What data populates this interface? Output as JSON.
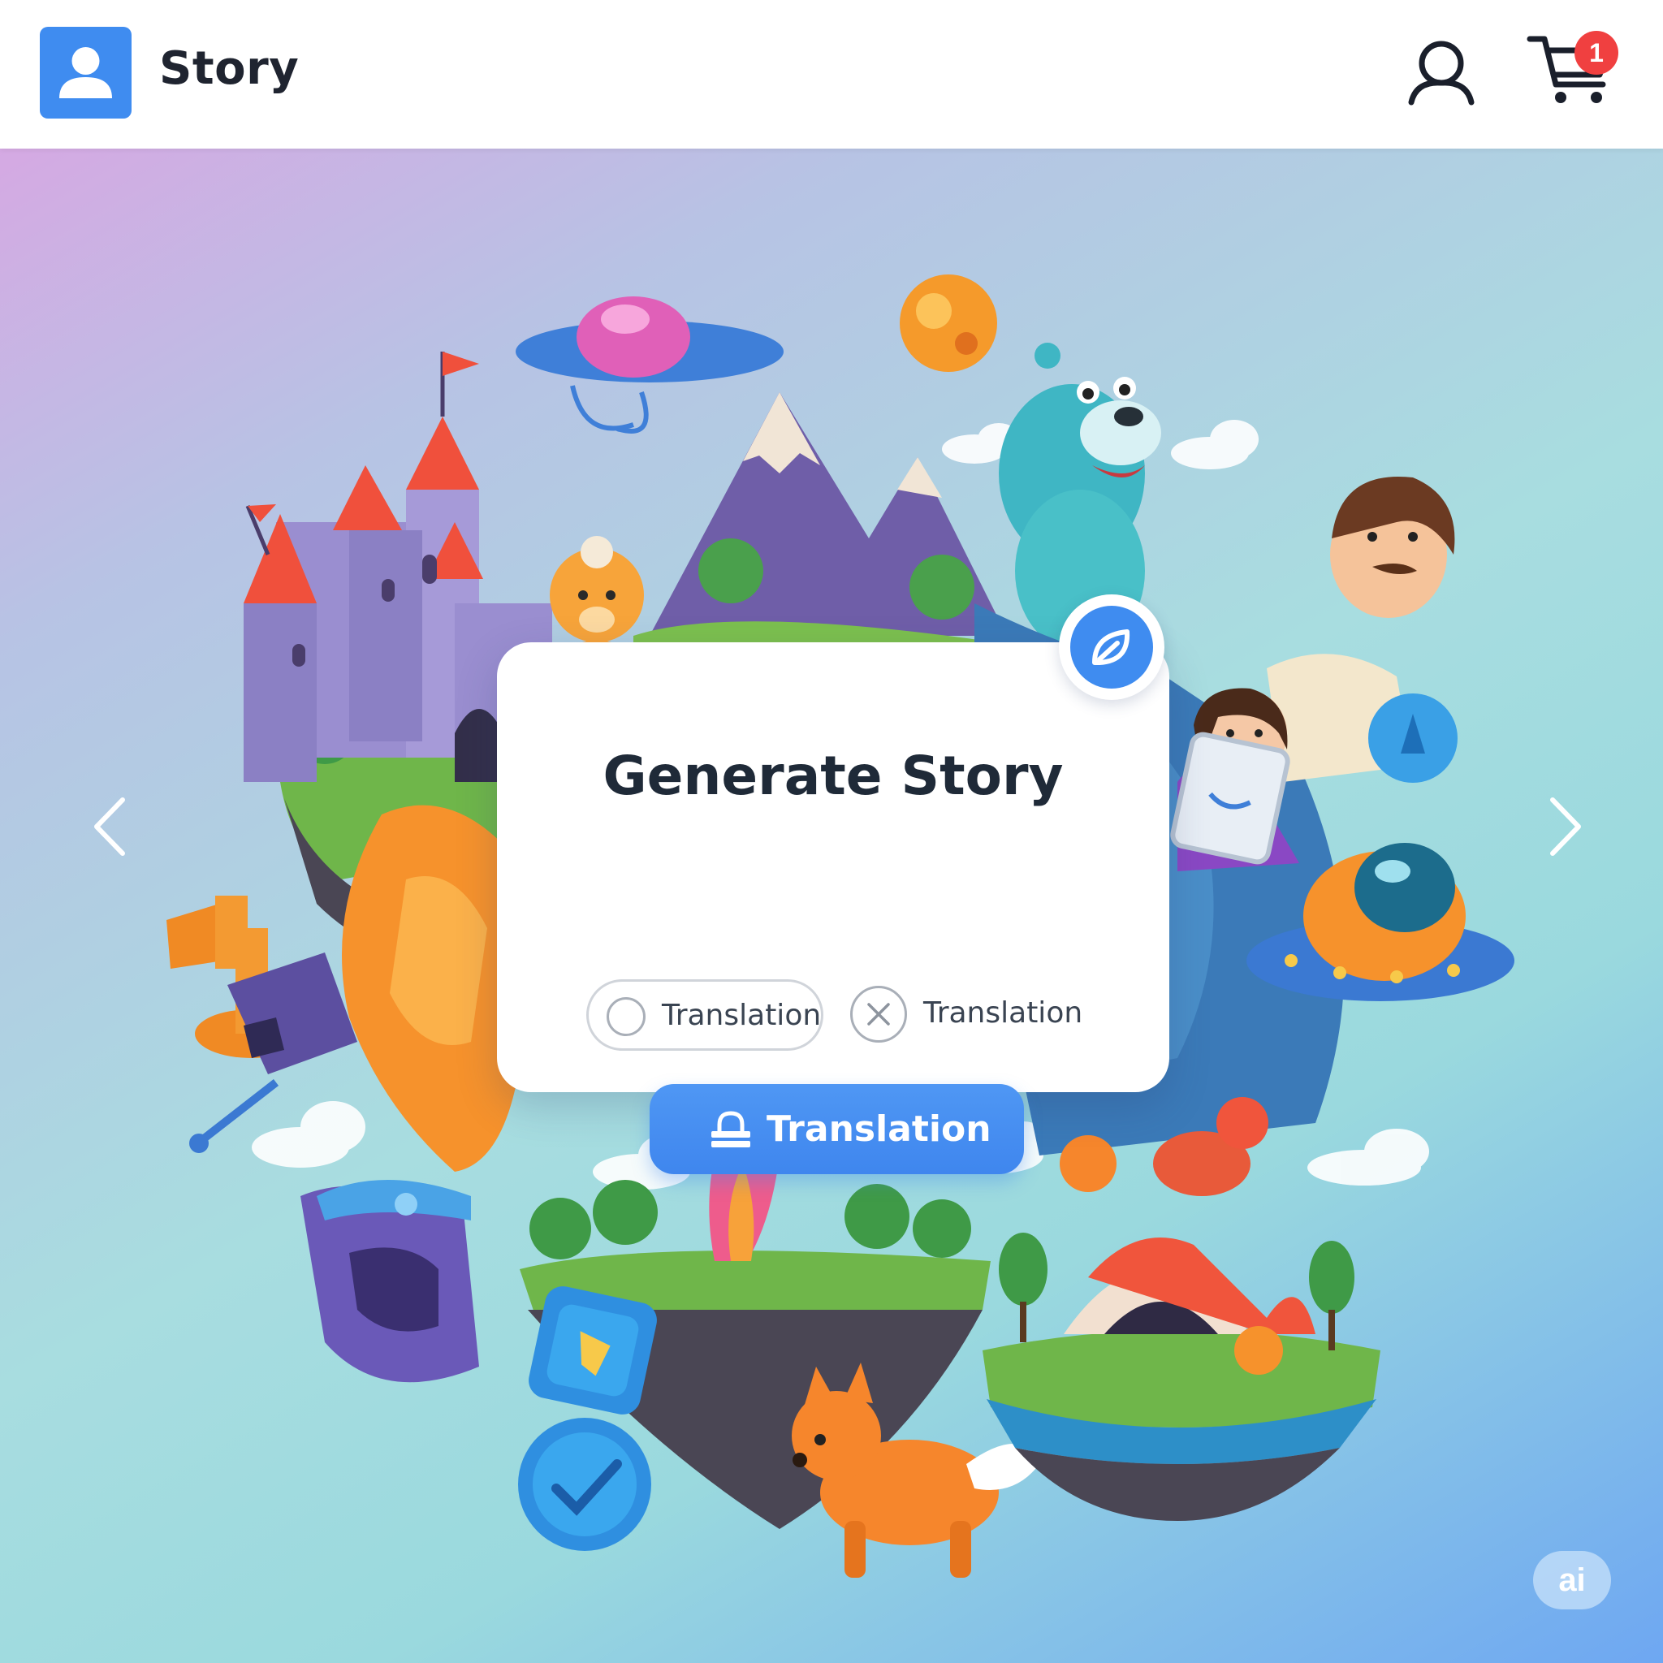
{
  "header": {
    "brand": "Story",
    "cart_count": "1",
    "icons": [
      "user-avatar-icon",
      "profile-icon",
      "cart-icon"
    ]
  },
  "hero": {
    "nav_prev_icon": "chevron-left-icon",
    "nav_next_icon": "chevron-right-icon"
  },
  "card": {
    "title": "Generate Story",
    "fab_icon": "leaf-icon",
    "option_a": {
      "label": "Translation",
      "icon": "radio-empty-icon"
    },
    "option_b": {
      "label": "Translation",
      "icon": "x-circle-icon"
    },
    "primary_button": {
      "label": "Translation",
      "icon": "lock-icon"
    }
  },
  "badge": {
    "label": "ai"
  },
  "colors": {
    "accent": "#3f8cf0",
    "badge_red": "#f04040",
    "text_dark": "#1f2a38"
  }
}
